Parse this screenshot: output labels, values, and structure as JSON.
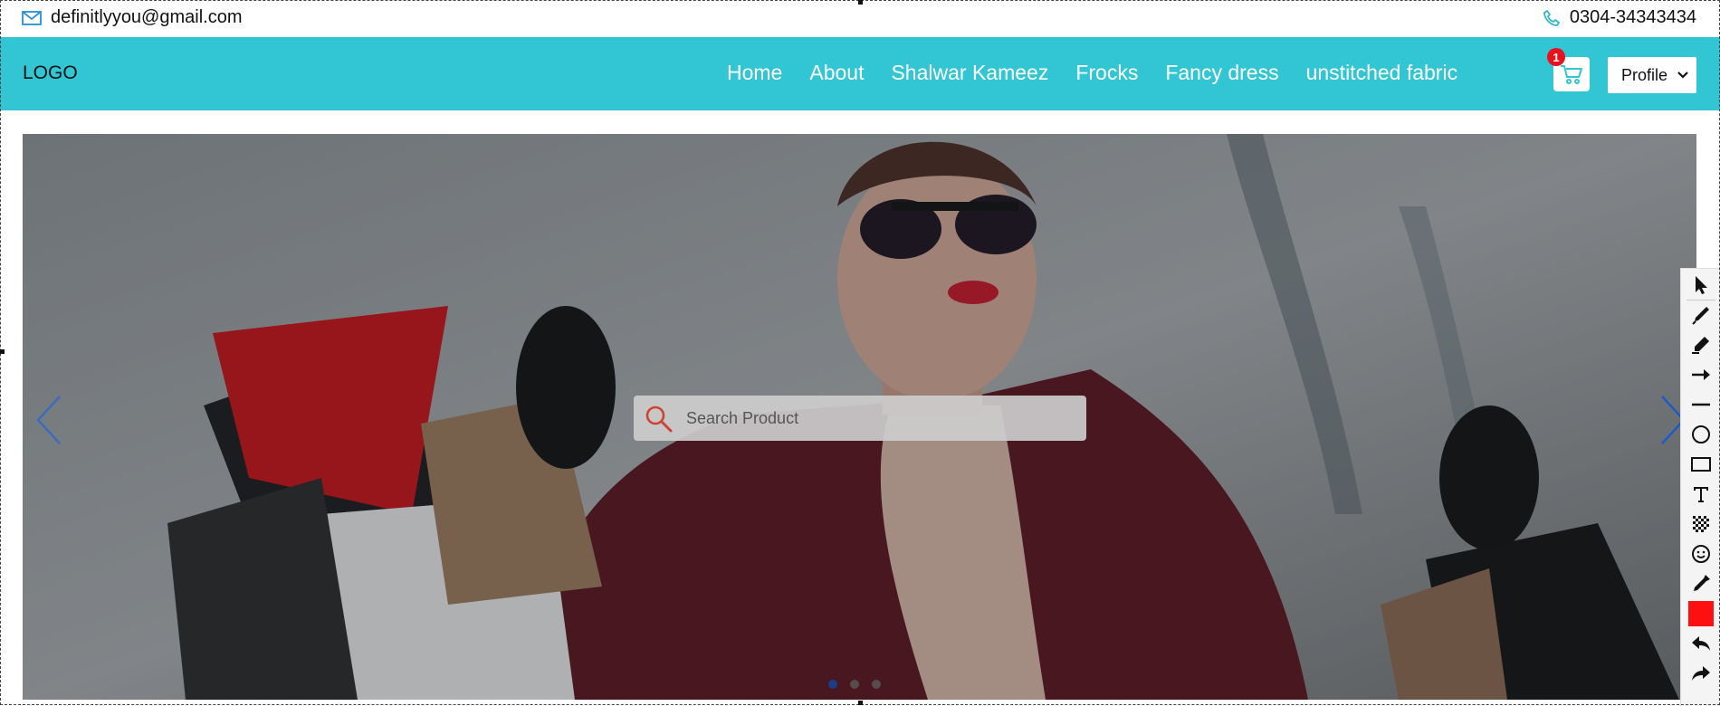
{
  "topbar": {
    "email": "definitlyyou@gmail.com",
    "phone": "0304-34343434",
    "email_icon": "mail-icon",
    "phone_icon": "phone-icon"
  },
  "navbar": {
    "logo": "LOGO",
    "links": [
      "Home",
      "About",
      "Shalwar Kameez",
      "Frocks",
      "Fancy dress",
      "unstitched fabric"
    ],
    "cart_count": "1",
    "cart_icon": "cart-icon",
    "profile_select": "Profile"
  },
  "hero": {
    "search_placeholder": "Search Product",
    "carousel_dots": 3,
    "active_dot": 1
  },
  "toolbar": {
    "tools": [
      "pointer-icon",
      "pen-icon",
      "marker-icon",
      "arrow-tool-icon",
      "line-tool-icon",
      "ellipse-tool-icon",
      "rectangle-tool-icon",
      "text-tool-icon",
      "blur-tool-icon",
      "emoji-icon",
      "eyedropper-icon",
      "color-swatch",
      "undo-icon",
      "redo-icon"
    ],
    "selected_color": "#ff1010"
  },
  "colors": {
    "nav_bg": "#32c6d4",
    "badge": "#e8121e",
    "active_dot": "#1a3e8a"
  }
}
